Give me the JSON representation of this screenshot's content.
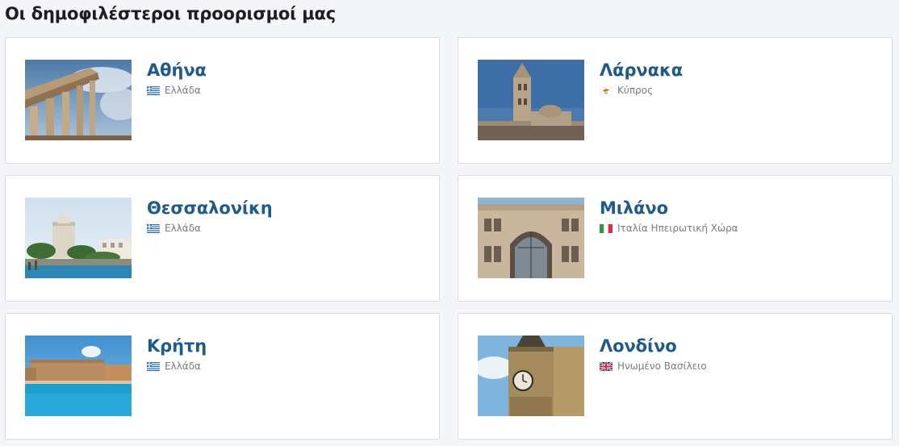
{
  "section": {
    "title": "Οι δημοφιλέστεροι προορισμοί μας"
  },
  "destinations": [
    {
      "city": "Αθήνα",
      "country": "Ελλάδα",
      "flag": "greece-flag-icon"
    },
    {
      "city": "Λάρνακα",
      "country": "Κύπρος",
      "flag": "cyprus-flag-icon"
    },
    {
      "city": "Θεσσαλονίκη",
      "country": "Ελλάδα",
      "flag": "greece-flag-icon"
    },
    {
      "city": "Μιλάνο",
      "country": "Ιταλία Ηπειρωτική Χώρα",
      "flag": "italy-flag-icon"
    },
    {
      "city": "Κρήτη",
      "country": "Ελλάδα",
      "flag": "greece-flag-icon"
    },
    {
      "city": "Λονδίνο",
      "country": "Ηνωμένο Βασίλειο",
      "flag": "uk-flag-icon"
    }
  ],
  "colors": {
    "city": "#1f5a8c",
    "country": "#777c82",
    "page_bg": "#f3f5f8"
  }
}
